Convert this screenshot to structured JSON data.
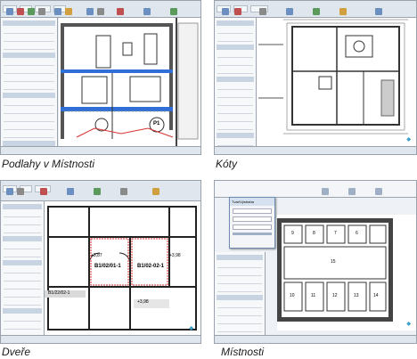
{
  "captions": {
    "floors": "Podlahy v Místnosti",
    "dimensions": "Kóty",
    "doors": "Dveře",
    "rooms": "Místnosti"
  },
  "labels": {
    "room_tag_1": "P1",
    "door_tag_left": "B1/02/01-1",
    "door_tag_right": "B1/02-02-1",
    "door_tag_bottom": "B1/22/02-1",
    "dim_left": "+3,87",
    "dim_right": "+3,98",
    "dim_bottom": "+3,98",
    "room_numbers": [
      "9",
      "8",
      "7",
      "6",
      "15",
      "10",
      "11",
      "12",
      "13",
      "14"
    ]
  },
  "dialog": {
    "title_row": "Tvar/Výstraha",
    "field_a": "",
    "field_b": ""
  },
  "colors": {
    "ribbon": "#dfe6ee",
    "accent_blue": "#2f6fd6",
    "selection_red": "#d93030",
    "logo": "#3aa0c8"
  }
}
